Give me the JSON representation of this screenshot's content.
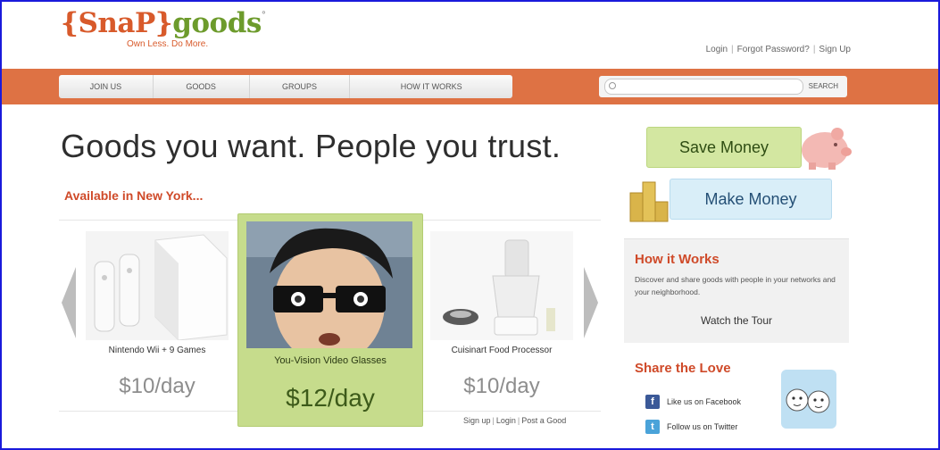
{
  "brand": {
    "logo_open": "{",
    "logo_snap": "SnaP",
    "logo_close": "}",
    "logo_goods": "goods",
    "logo_mark": "°",
    "tagline": "Own Less. Do More."
  },
  "top_links": {
    "login": "Login",
    "forgot": "Forgot Password?",
    "signup": "Sign Up",
    "sep": "|"
  },
  "nav": {
    "items": [
      {
        "label": "JOIN US"
      },
      {
        "label": "GOODS"
      },
      {
        "label": "GROUPS"
      },
      {
        "label": "HOW IT WORKS"
      }
    ],
    "search_value": "",
    "search_button": "SEARCH"
  },
  "hero": {
    "headline": "Goods you want. People you trust.",
    "availability": "Available in New York..."
  },
  "carousel": {
    "items": [
      {
        "name": "Nintendo Wii + 9 Games",
        "price": "$10/day"
      },
      {
        "name": "You-Vision Video Glasses",
        "price": "$12/day",
        "featured": true
      },
      {
        "name": "Cuisinart Food Processor",
        "price": "$10/day"
      }
    ]
  },
  "footer_links": {
    "signup": "Sign up",
    "login": "Login",
    "post": "Post a Good",
    "sep": "|"
  },
  "sidebar": {
    "save_money": "Save Money",
    "make_money": "Make Money",
    "how_it_works": {
      "title": "How it Works",
      "description": "Discover and share goods with people in your networks and your neighborhood.",
      "link": "Watch the Tour"
    },
    "share": {
      "title": "Share the Love",
      "facebook": "Like us on Facebook",
      "twitter": "Follow us on Twitter"
    }
  },
  "colors": {
    "accent_orange": "#de7244",
    "heading_red": "#cf4a29",
    "green_card": "#c6dc8c",
    "blue_button": "#d9eef8",
    "frame_border": "#1a1adb"
  },
  "icons": [
    "search-icon",
    "arrow-left-icon",
    "arrow-right-icon",
    "piggy-bank-icon",
    "coins-icon",
    "facebook-icon",
    "twitter-icon"
  ]
}
